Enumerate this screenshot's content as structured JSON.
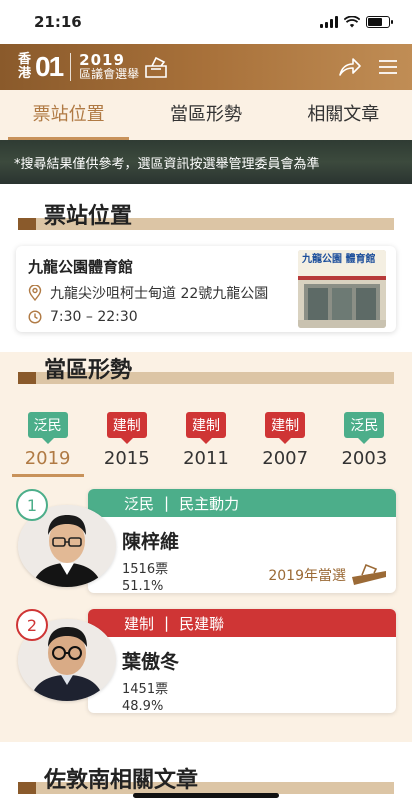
{
  "status_bar": {
    "time": "21:16"
  },
  "header": {
    "logo_hk_top": "香",
    "logo_hk_bottom": "港",
    "logo_01": "01",
    "year": "2019",
    "subtitle": "區議會選舉"
  },
  "tabs": [
    {
      "label": "票站位置",
      "active": true
    },
    {
      "label": "當區形勢",
      "active": false
    },
    {
      "label": "相關文章",
      "active": false
    }
  ],
  "disclaimer": "*搜尋結果僅供參考，選區資訊按選舉管理委員會為準",
  "station_section": {
    "title": "票站位置",
    "name": "九龍公園體育館",
    "address": "九龍尖沙咀柯士甸道 22號九龍公園",
    "hours": "7:30 – 22:30",
    "photo_sign": "九龍公園 體育館"
  },
  "area_section": {
    "title": "當區形勢",
    "years": [
      {
        "camp": "泛民",
        "year": "2019",
        "color": "green",
        "active": true
      },
      {
        "camp": "建制",
        "year": "2015",
        "color": "red",
        "active": false
      },
      {
        "camp": "建制",
        "year": "2011",
        "color": "red",
        "active": false
      },
      {
        "camp": "建制",
        "year": "2007",
        "color": "red",
        "active": false
      },
      {
        "camp": "泛民",
        "year": "2003",
        "color": "green",
        "active": false
      }
    ],
    "candidates": [
      {
        "number": "1",
        "camp": "泛民",
        "party": "民主動力",
        "name": "陳梓維",
        "votes": "1516票",
        "pct": "51.1%",
        "color": "green",
        "elected_label": "2019年當選"
      },
      {
        "number": "2",
        "camp": "建制",
        "party": "民建聯",
        "name": "葉傲冬",
        "votes": "1451票",
        "pct": "48.9%",
        "color": "red"
      }
    ],
    "separator": "|"
  },
  "related_section": {
    "title": "佐敦南相關文章"
  },
  "colors": {
    "brown": "#8a5a2b",
    "gold": "#b07a44",
    "green": "#4cae8a",
    "red": "#cf3535",
    "cream": "#fbf1e4"
  }
}
